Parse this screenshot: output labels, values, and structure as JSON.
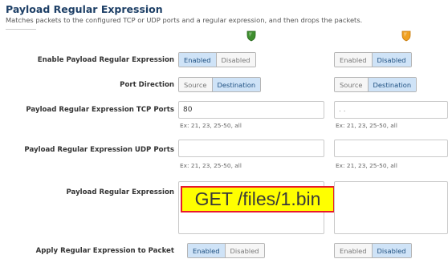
{
  "header": {
    "title": "Payload Regular Expression",
    "description": "Matches packets to the configured TCP or UDP ports and a regular expression, and then drops the packets."
  },
  "indicators": {
    "left_color": "#3e8e2e",
    "right_color": "#f0a020"
  },
  "rows": {
    "enable": {
      "label": "Enable Payload Regular Expression",
      "left": {
        "on": "Enabled",
        "off": "Disabled"
      },
      "right": {
        "on": "Enabled",
        "off": "Disabled"
      }
    },
    "direction": {
      "label": "Port Direction",
      "left": {
        "opt1": "Source",
        "opt2": "Destination"
      },
      "right": {
        "opt1": "Source",
        "opt2": "Destination"
      }
    },
    "tcp": {
      "label": "Payload Regular Expression TCP Ports",
      "left_value": "80",
      "right_value": ". .",
      "hint": "Ex: 21, 23, 25-50, all"
    },
    "udp": {
      "label": "Payload Regular Expression UDP Ports",
      "left_value": "",
      "right_value": "",
      "hint": "Ex: 21, 23, 25-50, all"
    },
    "regex": {
      "label": "Payload Regular Expression",
      "left_value": "GET /files/1.bin",
      "right_value": ""
    },
    "apply": {
      "label": "Apply Regular Expression to Packet",
      "left": {
        "on": "Enabled",
        "off": "Disabled"
      },
      "right": {
        "on": "Enabled",
        "off": "Disabled"
      }
    }
  }
}
